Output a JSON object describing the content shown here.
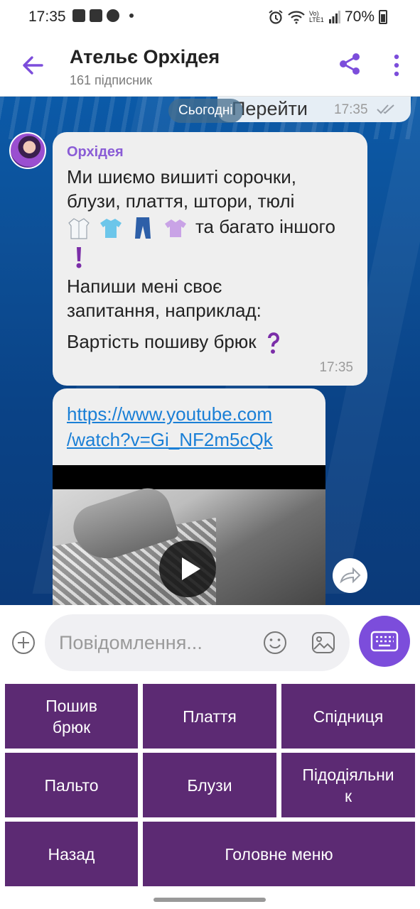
{
  "status": {
    "time": "17:35",
    "battery": "70%",
    "volte": "Vo) LTE1"
  },
  "header": {
    "title": "Ательє Орхідея",
    "subtitle": "161 підписник"
  },
  "chat": {
    "previous": {
      "text": "Перейти",
      "time": "17:35"
    },
    "date_pill": "Сьогодні",
    "message1": {
      "sender": "Орхідея",
      "line1": "Ми шиємо вишиті сорочки,",
      "line2": "блузи, плаття, штори, тюлі",
      "line3": "та багато іншого",
      "line4": "Напиши мені своє",
      "line5": "запитання, наприклад:",
      "line6": "Вартість пошиву брюк",
      "time": "17:35",
      "emojis": [
        "lab-coat-icon",
        "tshirt-icon",
        "jeans-icon",
        "blouse-icon",
        "exclamation-icon",
        "question-icon"
      ]
    },
    "message2": {
      "link_line1": "https://www.youtube.com",
      "link_line2": "/watch?v=Gi_NF2m5cQk"
    }
  },
  "input": {
    "placeholder": "Повідомлення..."
  },
  "keyboard": {
    "buttons": [
      {
        "line1": "Пошив",
        "line2": "брюк"
      },
      {
        "line1": "Плаття",
        "line2": ""
      },
      {
        "line1": "Спідниця",
        "line2": ""
      },
      {
        "line1": "Пальто",
        "line2": ""
      },
      {
        "line1": "Блузи",
        "line2": ""
      },
      {
        "line1": "Підодіяльни",
        "line2": "к"
      },
      {
        "line1": "Назад",
        "line2": ""
      },
      {
        "line1": "Головне меню",
        "line2": ""
      }
    ]
  },
  "colors": {
    "accent": "#7c4ddb",
    "button": "#5c2a73",
    "link": "#1a7fd6",
    "sender": "#8a5cd6"
  }
}
